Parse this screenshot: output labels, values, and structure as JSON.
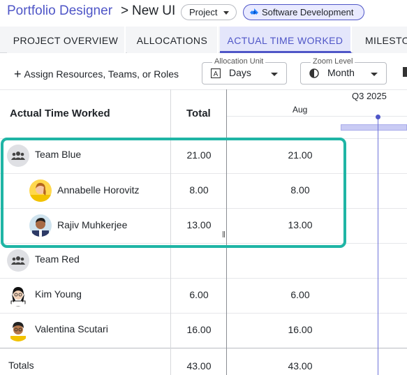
{
  "header": {
    "breadcrumb_root": "Portfolio Designer",
    "separator": ">",
    "page_title": "New UI",
    "project_pill": "Project",
    "category_pill": "Software Development"
  },
  "tabs": [
    {
      "label": "PROJECT OVERVIEW",
      "active": false
    },
    {
      "label": "ALLOCATIONS",
      "active": false
    },
    {
      "label": "ACTUAL TIME WORKED",
      "active": true
    },
    {
      "label": "MILESTO",
      "active": false
    }
  ],
  "toolbar": {
    "assign_label": "Assign Resources, Teams, or Roles",
    "allocation_unit": {
      "legend": "Allocation Unit",
      "value": "Days"
    },
    "zoom_level": {
      "legend": "Zoom Level",
      "value": "Month"
    }
  },
  "grid": {
    "name_header": "Actual Time Worked",
    "total_header": "Total",
    "quarter_label": "Q3 2025",
    "month_label": "Aug",
    "rows": [
      {
        "name": "Team Blue",
        "type": "team",
        "total": "21.00",
        "aug": "21.00"
      },
      {
        "name": "Annabelle Horovitz",
        "type": "person",
        "total": "8.00",
        "aug": "8.00"
      },
      {
        "name": "Rajiv Muhkerjee",
        "type": "person",
        "total": "13.00",
        "aug": "13.00"
      },
      {
        "name": "Team Red",
        "type": "team",
        "total": "",
        "aug": ""
      },
      {
        "name": "Kim Young",
        "type": "person",
        "total": "6.00",
        "aug": "6.00"
      },
      {
        "name": "Valentina Scutari",
        "type": "person",
        "total": "16.00",
        "aug": "16.00"
      }
    ],
    "totals": {
      "label": "Totals",
      "total": "43.00",
      "aug": "43.00"
    }
  },
  "colors": {
    "brand": "#4f56c7",
    "highlight": "#1fb5a5",
    "active_tab_bg": "#e4e6fb"
  }
}
